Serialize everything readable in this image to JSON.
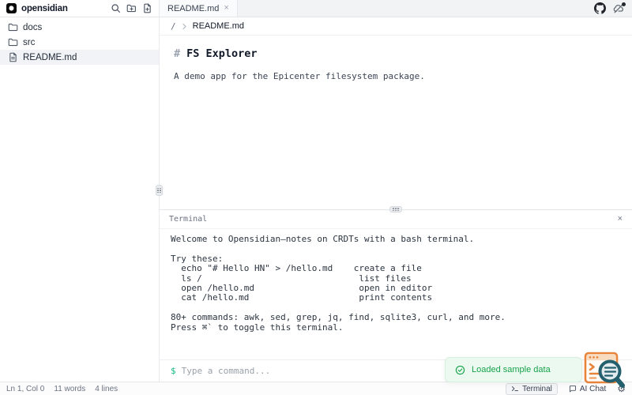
{
  "app": {
    "title": "opensidian"
  },
  "header": {
    "tab": {
      "label": "README.md",
      "close_glyph": "×"
    }
  },
  "sidebar": {
    "items": [
      {
        "label": "docs",
        "type": "folder"
      },
      {
        "label": "src",
        "type": "folder"
      },
      {
        "label": "README.md",
        "type": "file",
        "selected": true
      }
    ]
  },
  "breadcrumb": {
    "root": "/",
    "file": "README.md"
  },
  "editor": {
    "heading_hash": "#",
    "heading_text": "FS Explorer",
    "body_text": "A demo app for the Epicenter filesystem package."
  },
  "terminal": {
    "title": "Terminal",
    "close_glyph": "×",
    "lines": [
      "Welcome to Opensidian—notes on CRDTs with a bash terminal.",
      "",
      "Try these:",
      "  echo \"# Hello HN\" > /hello.md    create a file",
      "  ls /                              list files",
      "  open /hello.md                    open in editor",
      "  cat /hello.md                     print contents",
      "",
      "80+ commands: awk, sed, grep, jq, find, sqlite3, curl, and more.",
      "Press ⌘` to toggle this terminal."
    ],
    "prompt": "$",
    "input_value": "",
    "input_placeholder": "Type a command..."
  },
  "statusbar": {
    "cursor": "Ln 1, Col 0",
    "words": "11 words",
    "lines": "4 lines",
    "terminal_button": "Terminal",
    "ai_chat_button": "AI Chat",
    "gear_glyph": "⚙"
  },
  "toast": {
    "message": "Loaded sample data"
  },
  "colors": {
    "accent_green": "#10b981",
    "toast_green": "#16a34a",
    "toast_bg": "#ecf9f1",
    "selected_row_bg": "#f1f3f6",
    "border": "#e5e7eb",
    "logo_orange": "#e8833a",
    "glass_teal": "#235f6d"
  }
}
